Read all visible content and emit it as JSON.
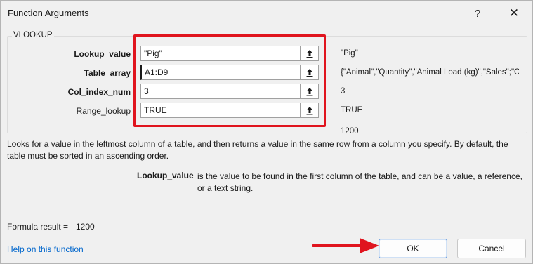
{
  "window": {
    "title": "Function Arguments",
    "help_glyph": "?",
    "close_glyph": "✕"
  },
  "function_name": "VLOOKUP",
  "arguments": [
    {
      "label": "Lookup_value",
      "value": "\"Pig\"",
      "result": "\"Pig\"",
      "required": true
    },
    {
      "label": "Table_array",
      "value": "A1:D9",
      "result": "{\"Animal\",\"Quantity\",\"Animal Load (kg)\",\"Sales\";\"Cc",
      "required": true
    },
    {
      "label": "Col_index_num",
      "value": "3",
      "result": "3",
      "required": true
    },
    {
      "label": "Range_lookup",
      "value": "TRUE",
      "result": "TRUE",
      "required": false
    }
  ],
  "equals_sign": "=",
  "function_result": "1200",
  "description": "Looks for a value in the leftmost column of a table, and then returns a value in the same row from a column you specify. By default, the table must be sorted in an ascending order.",
  "current_argument": {
    "name": "Lookup_value",
    "description": "is the value to be found in the first column of the table, and can be a value, a reference, or a text string."
  },
  "formula_result": {
    "label": "Formula result =",
    "value": "1200"
  },
  "help_link": "Help on this function",
  "buttons": {
    "ok": "OK",
    "cancel": "Cancel"
  },
  "annotation_color": "#e0141e",
  "icons": {
    "collapse": "upload-arrow-icon",
    "annotation_arrow": "red-arrow-icon"
  }
}
